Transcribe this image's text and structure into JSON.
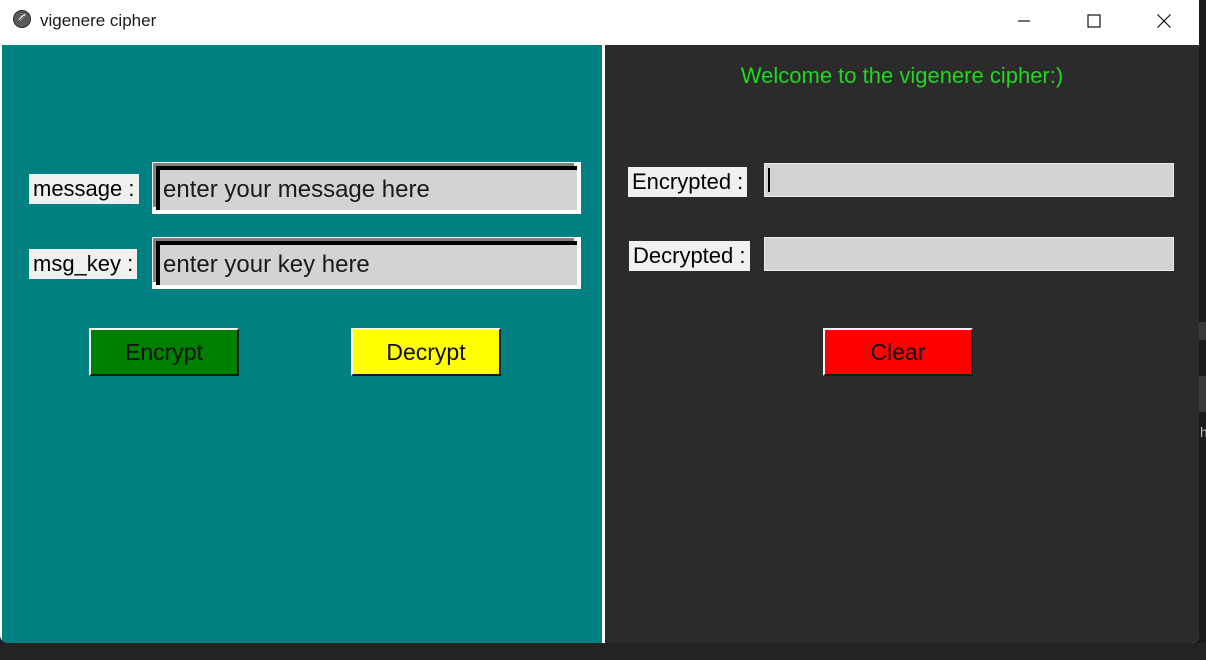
{
  "window": {
    "title": "vigenere cipher",
    "controls": {
      "minimize_icon": "minimize-icon",
      "maximize_icon": "maximize-icon",
      "close_icon": "close-icon"
    }
  },
  "left_panel": {
    "background": "#008080",
    "message": {
      "label": "message :",
      "placeholder": "enter your message here",
      "value": ""
    },
    "key": {
      "label": "msg_key :",
      "placeholder": "enter your key here",
      "value": ""
    },
    "encrypt_button": {
      "label": "Encrypt",
      "color": "#008000"
    },
    "decrypt_button": {
      "label": "Decrypt",
      "color": "#ffff00"
    }
  },
  "right_panel": {
    "background": "#2b2b2b",
    "welcome": "Welcome to the vigenere cipher:)",
    "welcome_color": "#22d622",
    "encrypted": {
      "label": "Encrypted :",
      "value": ""
    },
    "decrypted": {
      "label": "Decrypted :",
      "value": ""
    },
    "clear_button": {
      "label": "Clear",
      "color": "#ff0000"
    }
  },
  "background_window_glyph": "h"
}
